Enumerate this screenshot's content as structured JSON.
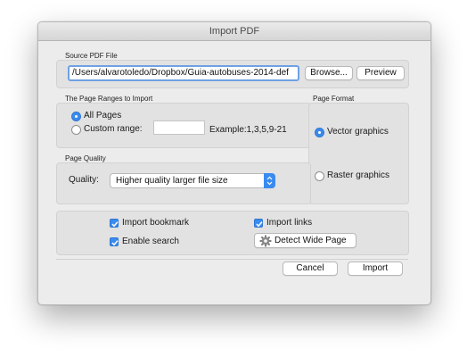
{
  "window": {
    "title": "Import PDF"
  },
  "source": {
    "label": "Source PDF File",
    "path": "/Users/alvarotoledo/Dropbox/Guia-autobuses-2014-def",
    "browse_label": "Browse...",
    "preview_label": "Preview"
  },
  "page_ranges": {
    "label": "The Page Ranges to Import",
    "all_pages_label": "All Pages",
    "all_pages_selected": true,
    "custom_range_label": "Custom range:",
    "custom_range_value": "",
    "example_text": "Example:1,3,5,9-21"
  },
  "page_format": {
    "label": "Page Format",
    "vector_label": "Vector graphics",
    "vector_selected": true,
    "raster_label": "Raster graphics"
  },
  "page_quality": {
    "label": "Page Quality",
    "quality_label": "Quality:",
    "selected_option": "Higher quality larger file size"
  },
  "options": {
    "import_bookmark_label": "Import bookmark",
    "import_bookmark_checked": true,
    "import_links_label": "Import links",
    "import_links_checked": true,
    "enable_search_label": "Enable search",
    "enable_search_checked": true,
    "detect_wide_page_label": "Detect Wide Page"
  },
  "footer": {
    "cancel_label": "Cancel",
    "import_label": "Import"
  },
  "colors": {
    "accent": "#3a8bef",
    "window_bg": "#ececec",
    "group_bg": "#e2e2e2"
  }
}
